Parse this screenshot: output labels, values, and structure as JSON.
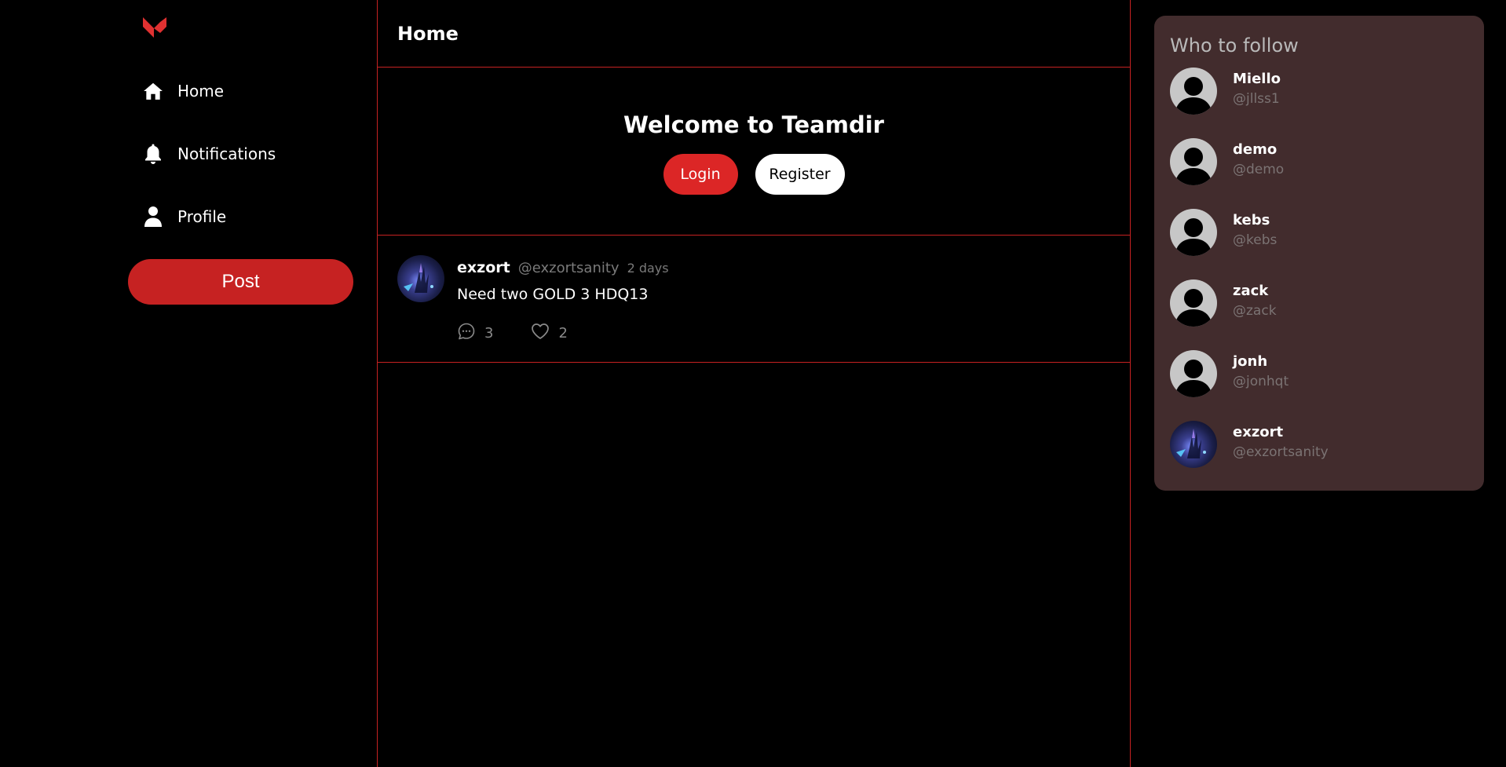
{
  "nav": {
    "items": [
      {
        "label": "Home",
        "icon": "home-icon"
      },
      {
        "label": "Notifications",
        "icon": "bell-icon"
      },
      {
        "label": "Profile",
        "icon": "user-icon"
      }
    ],
    "post_label": "Post"
  },
  "header": {
    "title": "Home"
  },
  "welcome": {
    "title": "Welcome to Teamdir",
    "login_label": "Login",
    "register_label": "Register"
  },
  "feed": [
    {
      "name": "exzort",
      "handle": "@exzortsanity",
      "time": "2 days",
      "text": "Need two GOLD 3 HDQ13",
      "comments": "3",
      "likes": "2"
    }
  ],
  "who_to_follow": {
    "title": "Who to follow",
    "users": [
      {
        "name": "Miello",
        "handle": "@jllss1"
      },
      {
        "name": "demo",
        "handle": "@demo"
      },
      {
        "name": "kebs",
        "handle": "@kebs"
      },
      {
        "name": "zack",
        "handle": "@zack"
      },
      {
        "name": "jonh",
        "handle": "@jonhqt"
      },
      {
        "name": "exzort",
        "handle": "@exzortsanity"
      }
    ]
  },
  "colors": {
    "accent": "#c62222",
    "panel": "#422c2d",
    "background": "#000000"
  }
}
